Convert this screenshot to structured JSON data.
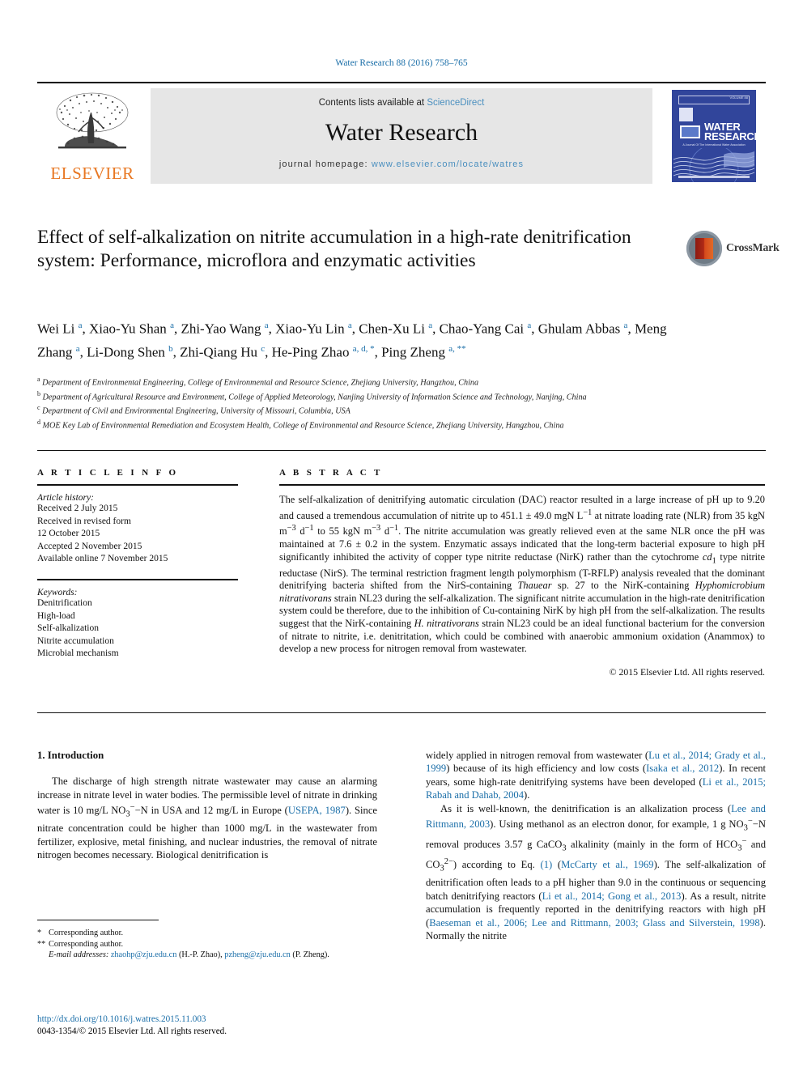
{
  "running_head": "Water Research 88 (2016) 758–765",
  "masthead": {
    "contents_prefix": "Contents lists available at",
    "contents_link": "ScienceDirect",
    "journal_title": "Water Research",
    "homepage_prefix": "journal homepage:",
    "homepage_url": "www.elsevier.com/locate/watres",
    "publisher": "ELSEVIER",
    "cover": {
      "name_line1": "WATER",
      "name_line2": "RESEARCH",
      "volume_label": "VOLUME 88",
      "tagline": "A Journal Of The International Water Association"
    }
  },
  "article": {
    "title": "Effect of self-alkalization on nitrite accumulation in a high-rate denitrification system: Performance, microflora and enzymatic activities",
    "crossmark_label": "CrossMark",
    "authors_html": "Wei Li <sup>a</sup>, Xiao-Yu Shan <sup>a</sup>, Zhi-Yao Wang <sup>a</sup>, Xiao-Yu Lin <sup>a</sup>, Chen-Xu Li <sup>a</sup>, Chao-Yang Cai <sup>a</sup>, Ghulam Abbas <sup>a</sup>, Meng Zhang <sup>a</sup>, Li-Dong Shen <sup>b</sup>, Zhi-Qiang Hu <sup>c</sup>, He-Ping Zhao <sup>a, d, *</sup>, Ping Zheng <sup>a, **</sup>",
    "affiliations": [
      {
        "label": "a",
        "text": "Department of Environmental Engineering, College of Environmental and Resource Science, Zhejiang University, Hangzhou, China"
      },
      {
        "label": "b",
        "text": "Department of Agricultural Resource and Environment, College of Applied Meteorology, Nanjing University of Information Science and Technology, Nanjing, China"
      },
      {
        "label": "c",
        "text": "Department of Civil and Environmental Engineering, University of Missouri, Columbia, USA"
      },
      {
        "label": "d",
        "text": "MOE Key Lab of Environmental Remediation and Ecosystem Health, College of Environmental and Resource Science, Zhejiang University, Hangzhou, China"
      }
    ]
  },
  "article_info": {
    "heading": "A R T I C L E  I N F O",
    "history_label": "Article history:",
    "history": [
      "Received 2 July 2015",
      "Received in revised form",
      "12 October 2015",
      "Accepted 2 November 2015",
      "Available online 7 November 2015"
    ],
    "keywords_label": "Keywords:",
    "keywords": [
      "Denitrification",
      "High-load",
      "Self-alkalization",
      "Nitrite accumulation",
      "Microbial mechanism"
    ]
  },
  "abstract": {
    "heading": "A B S T R A C T",
    "body_html": "The self-alkalization of denitrifying automatic circulation (DAC) reactor resulted in a large increase of pH up to 9.20 and caused a tremendous accumulation of nitrite up to 451.1 &plusmn; 49.0 mgN L<sup>&minus;1</sup> at nitrate loading rate (NLR) from 35 kgN m<sup>&minus;3</sup> d<sup>&minus;1</sup> to 55 kgN m<sup>&minus;3</sup> d<sup>&minus;1</sup>. The nitrite accumulation was greatly relieved even at the same NLR once the pH was maintained at 7.6 &plusmn; 0.2 in the system. Enzymatic assays indicated that the long-term bacterial exposure to high pH significantly inhibited the activity of copper type nitrite reductase (NirK) rather than the cytochrome <i>cd</i><sub>1</sub> type nitrite reductase (NirS). The terminal restriction fragment length polymorphism (T-RFLP) analysis revealed that the dominant denitrifying bacteria shifted from the NirS-containing <i>Thauear</i> sp. 27 to the NirK-containing <i>Hyphomicrobium nitrativorans</i> strain NL23 during the self-alkalization. The significant nitrite accumulation in the high-rate denitrification system could be therefore, due to the inhibition of Cu-containing NirK by high pH from the self-alkalization. The results suggest that the NirK-containing <i>H. nitrativorans</i> strain NL23 could be an ideal functional bacterium for the conversion of nitrate to nitrite, i.e. denitritation, which could be combined with anaerobic ammonium oxidation (Anammox) to develop a new process for nitrogen removal from wastewater.",
    "copyright": "© 2015 Elsevier Ltd. All rights reserved."
  },
  "introduction": {
    "heading": "1. Introduction",
    "left_paragraph_html": "The discharge of high strength nitrate wastewater may cause an alarming increase in nitrate level in water bodies. The permissible level of nitrate in drinking water is 10 mg/L NO<sub>3</sub><sup>&minus;</sup>&minus;N in USA and 12 mg/L in Europe (<span class=\"ref\">USEPA, 1987</span>). Since nitrate concentration could be higher than 1000 mg/L in the wastewater from fertilizer, explosive, metal finishing, and nuclear industries, the removal of nitrate nitrogen becomes necessary. Biological denitrification is",
    "right_paragraph1_html": "widely applied in nitrogen removal from wastewater (<span class=\"ref\">Lu et al., 2014; Grady et al., 1999</span>) because of its high efficiency and low costs (<span class=\"ref\">Isaka et al., 2012</span>). In recent years, some high-rate denitrifying systems have been developed (<span class=\"ref\">Li et al., 2015; Rabah and Dahab, 2004</span>).",
    "right_paragraph2_html": "As it is well-known, the denitrification is an alkalization process (<span class=\"ref\">Lee and Rittmann, 2003</span>). Using methanol as an electron donor, for example, 1 g NO<sub>3</sub><sup>&minus;</sup>&minus;N removal produces 3.57 g CaCO<sub>3</sub> alkalinity (mainly in the form of HCO<sub>3</sub><sup>&minus;</sup> and CO<sub>3</sub><sup>2&minus;</sup>) according to Eq. <span class=\"ref\">(1)</span> (<span class=\"ref\">McCarty et al., 1969</span>). The self-alkalization of denitrification often leads to a pH higher than 9.0 in the continuous or sequencing batch denitrifying reactors (<span class=\"ref\">Li et al., 2014; Gong et al., 2013</span>). As a result, nitrite accumulation is frequently reported in the denitrifying reactors with high pH (<span class=\"ref\">Baeseman et al., 2006; Lee and Rittmann, 2003; Glass and Silverstein, 1998</span>). Normally the nitrite"
  },
  "footnotes": [
    {
      "mark": "*",
      "html": "Corresponding author."
    },
    {
      "mark": "**",
      "html": "Corresponding author."
    },
    {
      "mark": "",
      "html": "<em>E-mail addresses:</em> <span class=\"ref\">zhaohp@zju.edu.cn</span> (H.-P. Zhao), <span class=\"ref\">pzheng@zju.edu.cn</span> (P. Zheng)."
    }
  ],
  "footer": {
    "doi": "http://dx.doi.org/10.1016/j.watres.2015.11.003",
    "issn_line": "0043-1354/© 2015 Elsevier Ltd. All rights reserved."
  },
  "colors": {
    "link": "#1a6ea8",
    "masthead_bg": "#e6e6e6",
    "cover_blue": "#31459b",
    "elsevier_orange": "#e87722"
  }
}
